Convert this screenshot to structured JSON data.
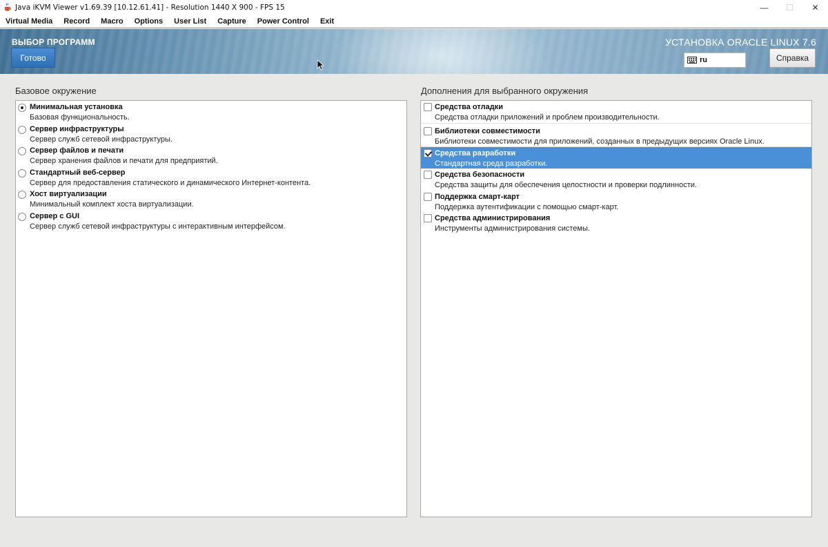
{
  "window": {
    "title": "Java iKVM Viewer v1.69.39 [10.12.61.41]  - Resolution 1440 X 900 - FPS 15",
    "icon": "java-cup-icon",
    "controls": [
      "minimize",
      "maximize",
      "close"
    ]
  },
  "menubar": {
    "items": [
      "Virtual Media",
      "Record",
      "Macro",
      "Options",
      "User List",
      "Capture",
      "Power Control",
      "Exit"
    ]
  },
  "header": {
    "spoke_title": "ВЫБОР ПРОГРАММ",
    "done_label": "Готово",
    "product_title": "УСТАНОВКА ORACLE LINUX 7.6",
    "keyboard_layout": "ru",
    "help_label": "Справка"
  },
  "base_environment": {
    "label": "Базовое окружение",
    "items": [
      {
        "name": "Минимальная установка",
        "desc": "Базовая функциональность.",
        "selected": true
      },
      {
        "name": "Сервер инфраструктуры",
        "desc": "Сервер служб сетевой инфраструктуры.",
        "selected": false
      },
      {
        "name": "Сервер файлов и печати",
        "desc": "Сервер хранения файлов и печати для предприятий.",
        "selected": false
      },
      {
        "name": "Стандартный веб-сервер",
        "desc": "Сервер для предоставления статического и динамического Интернет-контента.",
        "selected": false
      },
      {
        "name": "Хост виртуализации",
        "desc": "Минимальный комплект хоста виртуализации.",
        "selected": false
      },
      {
        "name": "Сервер с GUI",
        "desc": "Сервер служб сетевой инфраструктуры с интерактивным интерфейсом.",
        "selected": false
      }
    ]
  },
  "addons": {
    "label": "Дополнения для выбранного окружения",
    "items": [
      {
        "name": "Средства отладки",
        "desc": "Средства отладки приложений и проблем производительности.",
        "checked": false
      },
      {
        "name": "Библиотеки совместимости",
        "desc": "Библиотеки совместимости для приложений, созданных в предыдущих версиях Oracle Linux.",
        "checked": false
      },
      {
        "name": "Средства разработки",
        "desc": "Стандартная среда разработки.",
        "checked": true
      },
      {
        "name": "Средства безопасности",
        "desc": "Средства защиты для обеспечения целостности и проверки подлинности.",
        "checked": false
      },
      {
        "name": "Поддержка смарт-карт",
        "desc": "Поддержка аутентификации с помощью смарт-карт.",
        "checked": false
      },
      {
        "name": "Средства администрирования",
        "desc": "Инструменты администрирования системы.",
        "checked": false
      }
    ]
  },
  "colors": {
    "selection": "#4a90d9",
    "done_button": "#3a7fc4",
    "banner": "#6f9ab8"
  }
}
